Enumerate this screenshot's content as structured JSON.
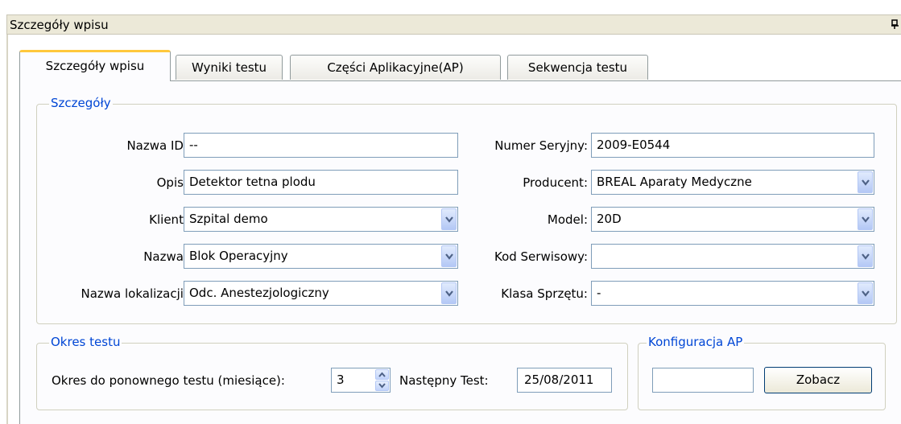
{
  "window": {
    "title": "Szczegóły wpisu"
  },
  "tabs": [
    {
      "label": "Szczegóły wpisu",
      "active": true
    },
    {
      "label": "Wyniki testu"
    },
    {
      "label": "Części Aplikacyjne(AP)"
    },
    {
      "label": "Sekwencja testu"
    }
  ],
  "details": {
    "legend": "Szczegóły",
    "left": [
      {
        "label": "Nazwa ID:",
        "value": "--"
      },
      {
        "label": "Opis:",
        "value": "Detektor tetna plodu"
      },
      {
        "label": "Klient:",
        "value": "Szpital demo"
      },
      {
        "label": "Nazwa:",
        "value": "Blok Operacyjny"
      },
      {
        "label": "Nazwa lokalizacji:",
        "value": "Odc. Anestezjologiczny"
      }
    ],
    "right": [
      {
        "label": "Numer Seryjny:",
        "value": "2009-E0544"
      },
      {
        "label": "Producent:",
        "value": "BREAL Aparaty Medyczne"
      },
      {
        "label": "Model:",
        "value": "20D"
      },
      {
        "label": "Kod Serwisowy:",
        "value": ""
      },
      {
        "label": "Klasa Sprzętu:",
        "value": "-"
      }
    ]
  },
  "test_period": {
    "legend": "Okres testu",
    "period_label": "Okres do ponownego testu (miesiące):",
    "period_value": "3",
    "next_label": "Następny Test:",
    "next_value": "25/08/2011"
  },
  "ap_config": {
    "legend": "Konfiguracja AP",
    "value": "",
    "button_label": "Zobacz"
  },
  "colors": {
    "legend": "#0046d5",
    "active_tab_accent": "#ffc83c",
    "border": "#7f9db9"
  }
}
